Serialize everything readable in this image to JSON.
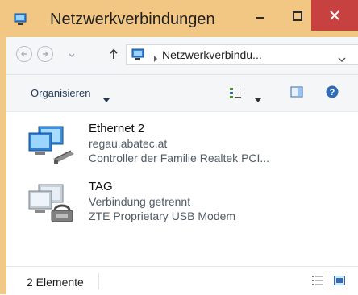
{
  "window": {
    "title": "Netzwerkverbindungen",
    "accent_color": "#f2c683",
    "close_color": "#c74140",
    "icons": [
      "network-connections-icon",
      "minimize-icon",
      "maximize-icon",
      "close-icon"
    ]
  },
  "address": {
    "breadcrumb": "Netzwerkverbindu...",
    "icons": [
      "back-arrow-icon",
      "forward-arrow-icon",
      "recent-locations-chevron-icon",
      "up-arrow-icon",
      "network-connections-icon",
      "breadcrumb-separator-icon",
      "address-dropdown-icon"
    ]
  },
  "toolbar": {
    "organize_label": "Organisieren",
    "icons": [
      "view-options-icon",
      "view-dropdown-icon",
      "preview-pane-icon",
      "help-icon"
    ]
  },
  "items": [
    {
      "name": "Ethernet 2",
      "status": "regau.abatec.at",
      "device": "Controller der Familie Realtek PCI...",
      "icon": "ethernet-adapter-icon"
    },
    {
      "name": "TAG",
      "status": "Verbindung getrennt",
      "device": "ZTE Proprietary USB Modem",
      "icon": "modem-connection-icon"
    }
  ],
  "statusbar": {
    "count": "2 Elemente",
    "icons": [
      "details-view-icon",
      "large-icons-view-icon"
    ]
  }
}
